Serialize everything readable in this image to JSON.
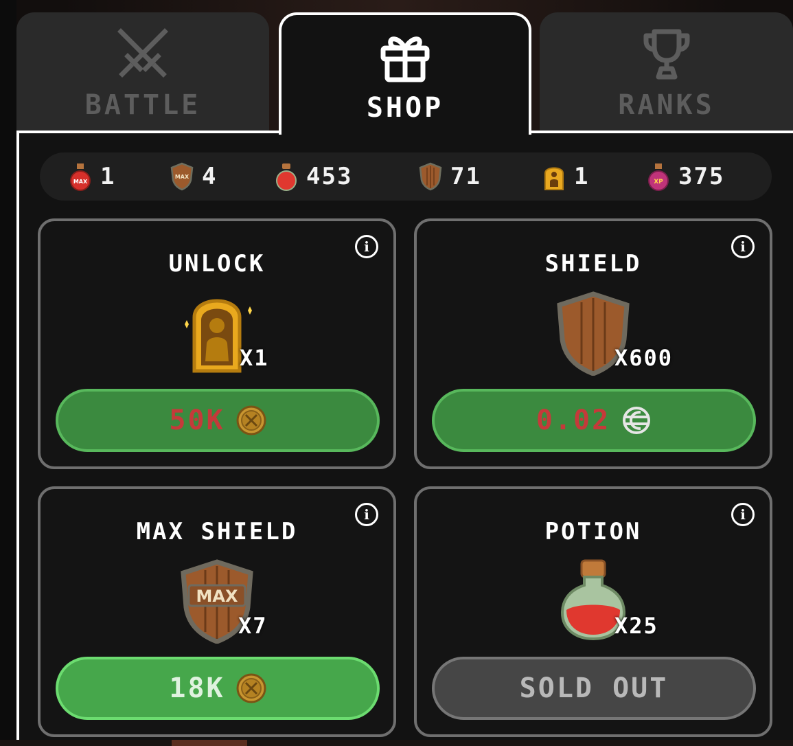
{
  "tabs": [
    {
      "label": "BATTLE",
      "icon": "crossed-swords-icon",
      "active": false
    },
    {
      "label": "SHOP",
      "icon": "gift-icon",
      "active": true
    },
    {
      "label": "RANKS",
      "icon": "trophy-icon",
      "active": false
    }
  ],
  "resources": [
    {
      "icon": "max-potion-icon",
      "value": "1"
    },
    {
      "icon": "max-shield-icon",
      "value": "4"
    },
    {
      "icon": "potion-icon",
      "value": "453"
    },
    {
      "icon": "shield-icon",
      "value": "71"
    },
    {
      "icon": "unlock-icon",
      "value": "1"
    },
    {
      "icon": "xp-potion-icon",
      "value": "375"
    }
  ],
  "cards": [
    {
      "title": "UNLOCK",
      "item_icon": "unlock-icon",
      "quantity": "X1",
      "price": "50K",
      "currency_icon": "coin-icon",
      "button_state": "unaffordable"
    },
    {
      "title": "SHIELD",
      "item_icon": "shield-icon",
      "quantity": "X600",
      "price": "0.02",
      "currency_icon": "crypto-token-icon",
      "button_state": "unaffordable"
    },
    {
      "title": "MAX SHIELD",
      "item_icon": "max-shield-icon",
      "quantity": "X7",
      "price": "18K",
      "currency_icon": "coin-icon",
      "button_state": "available"
    },
    {
      "title": "POTION",
      "item_icon": "potion-icon",
      "quantity": "X25",
      "price": "SOLD OUT",
      "currency_icon": "",
      "button_state": "sold-out"
    }
  ],
  "colors": {
    "button_green": "#3b8a3f",
    "button_green_active": "#46a74b",
    "price_unaffordable": "#c53a3a",
    "sold_out_grey": "#464646",
    "panel_bg": "#121212"
  }
}
